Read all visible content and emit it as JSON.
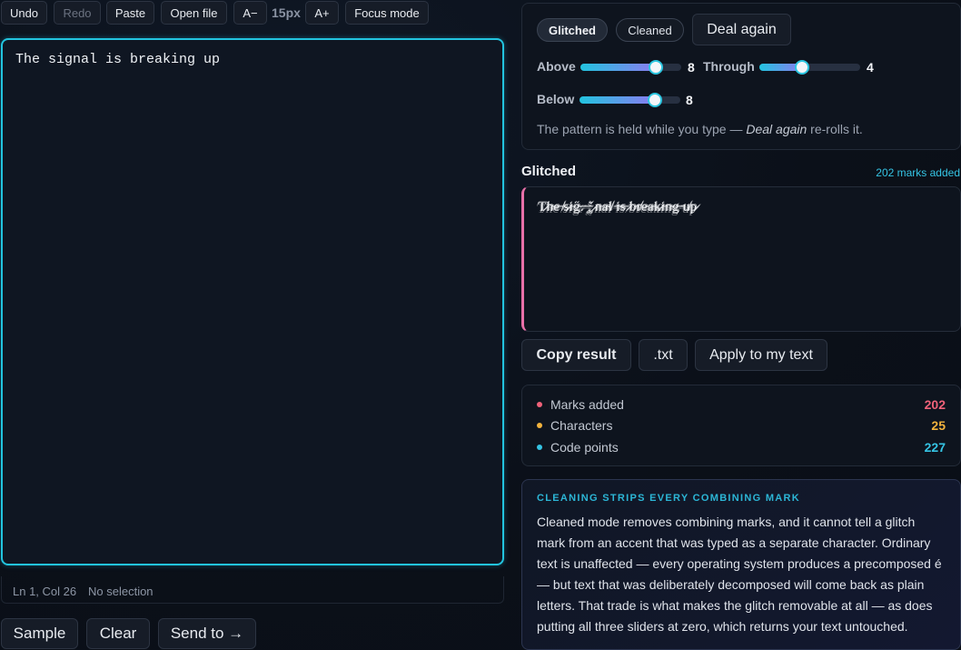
{
  "toolbar": {
    "undo": "Undo",
    "redo": "Redo",
    "paste": "Paste",
    "open_file": "Open file",
    "font_decrease": "A−",
    "font_size": "15px",
    "font_increase": "A+",
    "focus_mode": "Focus mode"
  },
  "editor": {
    "text": "The signal is breaking up"
  },
  "status": {
    "position": "Ln 1, Col 26",
    "selection": "No selection"
  },
  "bottom_buttons": {
    "sample": "Sample",
    "clear": "Clear",
    "send_to": "Send to →"
  },
  "controls": {
    "modes": {
      "glitched": "Glitched",
      "cleaned": "Cleaned",
      "selected": "Glitched"
    },
    "deal_again": "Deal again",
    "sliders": {
      "above": {
        "label": "Above",
        "value": "8",
        "fraction": 0.75
      },
      "through": {
        "label": "Through",
        "value": "4",
        "fraction": 0.42
      },
      "below": {
        "label": "Below",
        "value": "8",
        "fraction": 0.75
      }
    },
    "hint_before": "The pattern is held while you type — ",
    "hint_em": "Deal again",
    "hint_after": " re-rolls it."
  },
  "output": {
    "heading": "Glitched",
    "marks_added_label": "202 marks added",
    "text": "T̷h̴e̶ ̸s̷i̵g̴̈.̵ ̶͔͘,̵̥̌ ̷n̶a̴l̸ ̵i̴s̶ ̷b̵r̸e̴a̶k̷i̵n̴g̶ ̵u̸p̷"
  },
  "output_buttons": {
    "copy": "Copy result",
    "txt": ".txt",
    "apply": "Apply to my text"
  },
  "stats": [
    {
      "label": "Marks added",
      "value": "202",
      "color": "#f0627a"
    },
    {
      "label": "Characters",
      "value": "25",
      "color": "#f2b33d"
    },
    {
      "label": "Code points",
      "value": "227",
      "color": "#35c4e4"
    }
  ],
  "note": {
    "title": "CLEANING STRIPS EVERY COMBINING MARK",
    "body": "Cleaned mode removes combining marks, and it cannot tell a glitch mark from an accent that was typed as a separate character. Ordinary text is unaffected — every operating system produces a precomposed é — but text that was deliberately decomposed will come back as plain letters. That trade is what makes the glitch removable at all — as does putting all three sliders at zero, which returns your text untouched."
  },
  "colors": {
    "accent": "#22c4df",
    "glitch_border": "#e870a8"
  }
}
